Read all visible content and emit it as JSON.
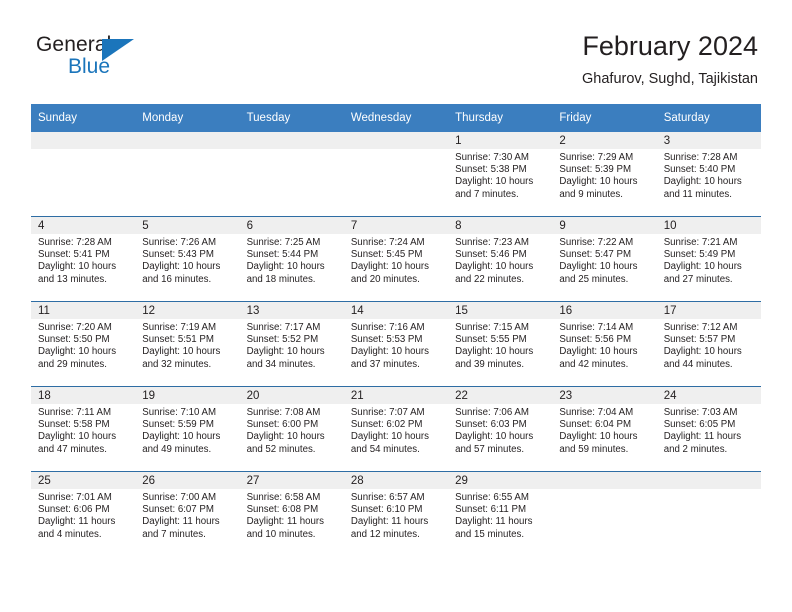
{
  "brand": {
    "name_part1": "General",
    "name_part2": "Blue",
    "accent_color": "#1b75bb"
  },
  "header": {
    "title": "February 2024",
    "subtitle": "Ghafurov, Sughd, Tajikistan"
  },
  "theme": {
    "header_bg": "#3b7ebf",
    "header_text": "#ffffff",
    "row_divider": "#2e6da4",
    "daynum_band": "#efefef",
    "body_text": "#231f20"
  },
  "weekdays": [
    "Sunday",
    "Monday",
    "Tuesday",
    "Wednesday",
    "Thursday",
    "Friday",
    "Saturday"
  ],
  "weeks": [
    [
      {
        "day": "",
        "sunrise": "",
        "sunset": "",
        "daylight1": "",
        "daylight2": ""
      },
      {
        "day": "",
        "sunrise": "",
        "sunset": "",
        "daylight1": "",
        "daylight2": ""
      },
      {
        "day": "",
        "sunrise": "",
        "sunset": "",
        "daylight1": "",
        "daylight2": ""
      },
      {
        "day": "",
        "sunrise": "",
        "sunset": "",
        "daylight1": "",
        "daylight2": ""
      },
      {
        "day": "1",
        "sunrise": "Sunrise: 7:30 AM",
        "sunset": "Sunset: 5:38 PM",
        "daylight1": "Daylight: 10 hours",
        "daylight2": "and 7 minutes."
      },
      {
        "day": "2",
        "sunrise": "Sunrise: 7:29 AM",
        "sunset": "Sunset: 5:39 PM",
        "daylight1": "Daylight: 10 hours",
        "daylight2": "and 9 minutes."
      },
      {
        "day": "3",
        "sunrise": "Sunrise: 7:28 AM",
        "sunset": "Sunset: 5:40 PM",
        "daylight1": "Daylight: 10 hours",
        "daylight2": "and 11 minutes."
      }
    ],
    [
      {
        "day": "4",
        "sunrise": "Sunrise: 7:28 AM",
        "sunset": "Sunset: 5:41 PM",
        "daylight1": "Daylight: 10 hours",
        "daylight2": "and 13 minutes."
      },
      {
        "day": "5",
        "sunrise": "Sunrise: 7:26 AM",
        "sunset": "Sunset: 5:43 PM",
        "daylight1": "Daylight: 10 hours",
        "daylight2": "and 16 minutes."
      },
      {
        "day": "6",
        "sunrise": "Sunrise: 7:25 AM",
        "sunset": "Sunset: 5:44 PM",
        "daylight1": "Daylight: 10 hours",
        "daylight2": "and 18 minutes."
      },
      {
        "day": "7",
        "sunrise": "Sunrise: 7:24 AM",
        "sunset": "Sunset: 5:45 PM",
        "daylight1": "Daylight: 10 hours",
        "daylight2": "and 20 minutes."
      },
      {
        "day": "8",
        "sunrise": "Sunrise: 7:23 AM",
        "sunset": "Sunset: 5:46 PM",
        "daylight1": "Daylight: 10 hours",
        "daylight2": "and 22 minutes."
      },
      {
        "day": "9",
        "sunrise": "Sunrise: 7:22 AM",
        "sunset": "Sunset: 5:47 PM",
        "daylight1": "Daylight: 10 hours",
        "daylight2": "and 25 minutes."
      },
      {
        "day": "10",
        "sunrise": "Sunrise: 7:21 AM",
        "sunset": "Sunset: 5:49 PM",
        "daylight1": "Daylight: 10 hours",
        "daylight2": "and 27 minutes."
      }
    ],
    [
      {
        "day": "11",
        "sunrise": "Sunrise: 7:20 AM",
        "sunset": "Sunset: 5:50 PM",
        "daylight1": "Daylight: 10 hours",
        "daylight2": "and 29 minutes."
      },
      {
        "day": "12",
        "sunrise": "Sunrise: 7:19 AM",
        "sunset": "Sunset: 5:51 PM",
        "daylight1": "Daylight: 10 hours",
        "daylight2": "and 32 minutes."
      },
      {
        "day": "13",
        "sunrise": "Sunrise: 7:17 AM",
        "sunset": "Sunset: 5:52 PM",
        "daylight1": "Daylight: 10 hours",
        "daylight2": "and 34 minutes."
      },
      {
        "day": "14",
        "sunrise": "Sunrise: 7:16 AM",
        "sunset": "Sunset: 5:53 PM",
        "daylight1": "Daylight: 10 hours",
        "daylight2": "and 37 minutes."
      },
      {
        "day": "15",
        "sunrise": "Sunrise: 7:15 AM",
        "sunset": "Sunset: 5:55 PM",
        "daylight1": "Daylight: 10 hours",
        "daylight2": "and 39 minutes."
      },
      {
        "day": "16",
        "sunrise": "Sunrise: 7:14 AM",
        "sunset": "Sunset: 5:56 PM",
        "daylight1": "Daylight: 10 hours",
        "daylight2": "and 42 minutes."
      },
      {
        "day": "17",
        "sunrise": "Sunrise: 7:12 AM",
        "sunset": "Sunset: 5:57 PM",
        "daylight1": "Daylight: 10 hours",
        "daylight2": "and 44 minutes."
      }
    ],
    [
      {
        "day": "18",
        "sunrise": "Sunrise: 7:11 AM",
        "sunset": "Sunset: 5:58 PM",
        "daylight1": "Daylight: 10 hours",
        "daylight2": "and 47 minutes."
      },
      {
        "day": "19",
        "sunrise": "Sunrise: 7:10 AM",
        "sunset": "Sunset: 5:59 PM",
        "daylight1": "Daylight: 10 hours",
        "daylight2": "and 49 minutes."
      },
      {
        "day": "20",
        "sunrise": "Sunrise: 7:08 AM",
        "sunset": "Sunset: 6:00 PM",
        "daylight1": "Daylight: 10 hours",
        "daylight2": "and 52 minutes."
      },
      {
        "day": "21",
        "sunrise": "Sunrise: 7:07 AM",
        "sunset": "Sunset: 6:02 PM",
        "daylight1": "Daylight: 10 hours",
        "daylight2": "and 54 minutes."
      },
      {
        "day": "22",
        "sunrise": "Sunrise: 7:06 AM",
        "sunset": "Sunset: 6:03 PM",
        "daylight1": "Daylight: 10 hours",
        "daylight2": "and 57 minutes."
      },
      {
        "day": "23",
        "sunrise": "Sunrise: 7:04 AM",
        "sunset": "Sunset: 6:04 PM",
        "daylight1": "Daylight: 10 hours",
        "daylight2": "and 59 minutes."
      },
      {
        "day": "24",
        "sunrise": "Sunrise: 7:03 AM",
        "sunset": "Sunset: 6:05 PM",
        "daylight1": "Daylight: 11 hours",
        "daylight2": "and 2 minutes."
      }
    ],
    [
      {
        "day": "25",
        "sunrise": "Sunrise: 7:01 AM",
        "sunset": "Sunset: 6:06 PM",
        "daylight1": "Daylight: 11 hours",
        "daylight2": "and 4 minutes."
      },
      {
        "day": "26",
        "sunrise": "Sunrise: 7:00 AM",
        "sunset": "Sunset: 6:07 PM",
        "daylight1": "Daylight: 11 hours",
        "daylight2": "and 7 minutes."
      },
      {
        "day": "27",
        "sunrise": "Sunrise: 6:58 AM",
        "sunset": "Sunset: 6:08 PM",
        "daylight1": "Daylight: 11 hours",
        "daylight2": "and 10 minutes."
      },
      {
        "day": "28",
        "sunrise": "Sunrise: 6:57 AM",
        "sunset": "Sunset: 6:10 PM",
        "daylight1": "Daylight: 11 hours",
        "daylight2": "and 12 minutes."
      },
      {
        "day": "29",
        "sunrise": "Sunrise: 6:55 AM",
        "sunset": "Sunset: 6:11 PM",
        "daylight1": "Daylight: 11 hours",
        "daylight2": "and 15 minutes."
      },
      {
        "day": "",
        "sunrise": "",
        "sunset": "",
        "daylight1": "",
        "daylight2": ""
      },
      {
        "day": "",
        "sunrise": "",
        "sunset": "",
        "daylight1": "",
        "daylight2": ""
      }
    ]
  ]
}
